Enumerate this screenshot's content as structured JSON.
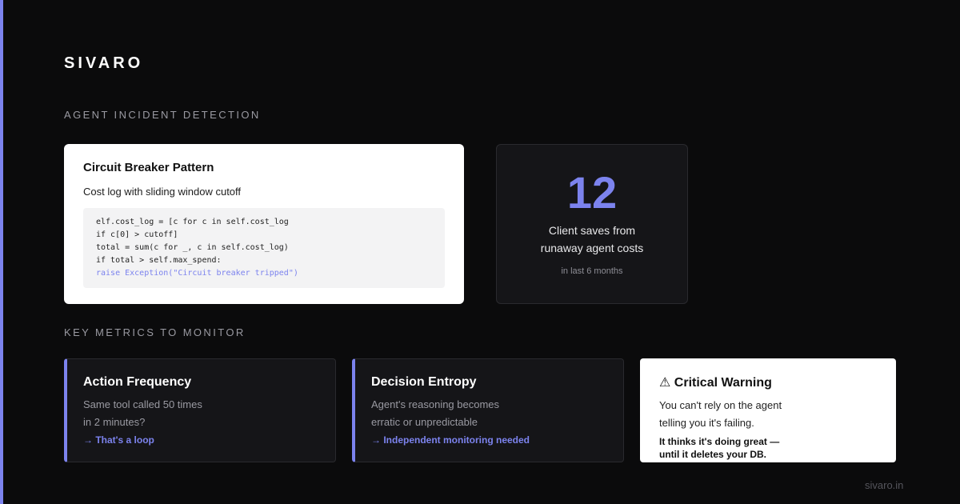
{
  "brand": "SIVARO",
  "section1": {
    "label": "AGENT INCIDENT DETECTION"
  },
  "code_card": {
    "title": "Circuit Breaker Pattern",
    "subtitle": "Cost log with sliding window cutoff",
    "code_lines": [
      "elf.cost_log = [c for c in self.cost_log",
      "if c[0] > cutoff]",
      "total = sum(c for _, c in self.cost_log)",
      "if total > self.max_spend:",
      "raise Exception(\"Circuit breaker tripped\")"
    ]
  },
  "stat_card": {
    "number": "12",
    "text_line1": "Client saves from",
    "text_line2": "runaway agent costs",
    "note": "in last 6 months"
  },
  "section2": {
    "label": "KEY METRICS TO MONITOR"
  },
  "metrics": [
    {
      "title": "Action Frequency",
      "desc_line1": "Same tool called 50 times",
      "desc_line2": "in 2 minutes?",
      "link": "→ That's a loop"
    },
    {
      "title": "Decision Entropy",
      "desc_line1": "Agent's reasoning becomes",
      "desc_line2": "erratic or unpredictable",
      "link": "→ Independent monitoring needed"
    }
  ],
  "warning": {
    "title": "⚠ Critical Warning",
    "desc_line1": "You can't rely on the agent",
    "desc_line2": "telling you it's failing.",
    "bold_line1": "It thinks it's doing great —",
    "bold_line2": "until it deletes your DB."
  },
  "footer": "sivaro.in",
  "colors": {
    "accent": "#7c83ee",
    "background": "#0b0b0c",
    "card_dark": "#151518"
  }
}
